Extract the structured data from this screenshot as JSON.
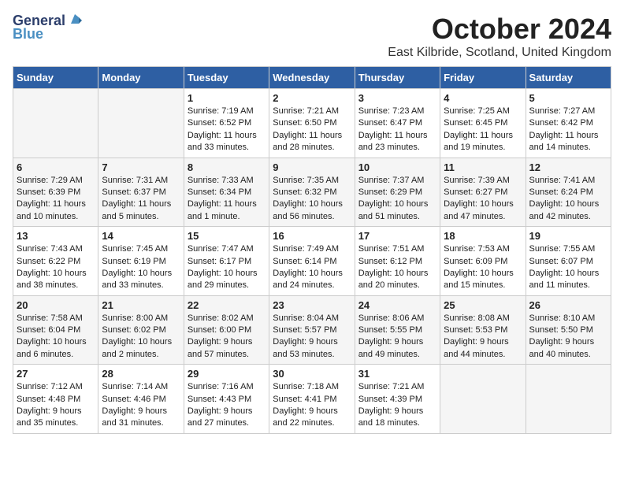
{
  "logo": {
    "general": "General",
    "blue": "Blue"
  },
  "title": "October 2024",
  "location": "East Kilbride, Scotland, United Kingdom",
  "days_of_week": [
    "Sunday",
    "Monday",
    "Tuesday",
    "Wednesday",
    "Thursday",
    "Friday",
    "Saturday"
  ],
  "weeks": [
    [
      {
        "day": "",
        "info": ""
      },
      {
        "day": "",
        "info": ""
      },
      {
        "day": "1",
        "info": "Sunrise: 7:19 AM\nSunset: 6:52 PM\nDaylight: 11 hours\nand 33 minutes."
      },
      {
        "day": "2",
        "info": "Sunrise: 7:21 AM\nSunset: 6:50 PM\nDaylight: 11 hours\nand 28 minutes."
      },
      {
        "day": "3",
        "info": "Sunrise: 7:23 AM\nSunset: 6:47 PM\nDaylight: 11 hours\nand 23 minutes."
      },
      {
        "day": "4",
        "info": "Sunrise: 7:25 AM\nSunset: 6:45 PM\nDaylight: 11 hours\nand 19 minutes."
      },
      {
        "day": "5",
        "info": "Sunrise: 7:27 AM\nSunset: 6:42 PM\nDaylight: 11 hours\nand 14 minutes."
      }
    ],
    [
      {
        "day": "6",
        "info": "Sunrise: 7:29 AM\nSunset: 6:39 PM\nDaylight: 11 hours\nand 10 minutes."
      },
      {
        "day": "7",
        "info": "Sunrise: 7:31 AM\nSunset: 6:37 PM\nDaylight: 11 hours\nand 5 minutes."
      },
      {
        "day": "8",
        "info": "Sunrise: 7:33 AM\nSunset: 6:34 PM\nDaylight: 11 hours\nand 1 minute."
      },
      {
        "day": "9",
        "info": "Sunrise: 7:35 AM\nSunset: 6:32 PM\nDaylight: 10 hours\nand 56 minutes."
      },
      {
        "day": "10",
        "info": "Sunrise: 7:37 AM\nSunset: 6:29 PM\nDaylight: 10 hours\nand 51 minutes."
      },
      {
        "day": "11",
        "info": "Sunrise: 7:39 AM\nSunset: 6:27 PM\nDaylight: 10 hours\nand 47 minutes."
      },
      {
        "day": "12",
        "info": "Sunrise: 7:41 AM\nSunset: 6:24 PM\nDaylight: 10 hours\nand 42 minutes."
      }
    ],
    [
      {
        "day": "13",
        "info": "Sunrise: 7:43 AM\nSunset: 6:22 PM\nDaylight: 10 hours\nand 38 minutes."
      },
      {
        "day": "14",
        "info": "Sunrise: 7:45 AM\nSunset: 6:19 PM\nDaylight: 10 hours\nand 33 minutes."
      },
      {
        "day": "15",
        "info": "Sunrise: 7:47 AM\nSunset: 6:17 PM\nDaylight: 10 hours\nand 29 minutes."
      },
      {
        "day": "16",
        "info": "Sunrise: 7:49 AM\nSunset: 6:14 PM\nDaylight: 10 hours\nand 24 minutes."
      },
      {
        "day": "17",
        "info": "Sunrise: 7:51 AM\nSunset: 6:12 PM\nDaylight: 10 hours\nand 20 minutes."
      },
      {
        "day": "18",
        "info": "Sunrise: 7:53 AM\nSunset: 6:09 PM\nDaylight: 10 hours\nand 15 minutes."
      },
      {
        "day": "19",
        "info": "Sunrise: 7:55 AM\nSunset: 6:07 PM\nDaylight: 10 hours\nand 11 minutes."
      }
    ],
    [
      {
        "day": "20",
        "info": "Sunrise: 7:58 AM\nSunset: 6:04 PM\nDaylight: 10 hours\nand 6 minutes."
      },
      {
        "day": "21",
        "info": "Sunrise: 8:00 AM\nSunset: 6:02 PM\nDaylight: 10 hours\nand 2 minutes."
      },
      {
        "day": "22",
        "info": "Sunrise: 8:02 AM\nSunset: 6:00 PM\nDaylight: 9 hours\nand 57 minutes."
      },
      {
        "day": "23",
        "info": "Sunrise: 8:04 AM\nSunset: 5:57 PM\nDaylight: 9 hours\nand 53 minutes."
      },
      {
        "day": "24",
        "info": "Sunrise: 8:06 AM\nSunset: 5:55 PM\nDaylight: 9 hours\nand 49 minutes."
      },
      {
        "day": "25",
        "info": "Sunrise: 8:08 AM\nSunset: 5:53 PM\nDaylight: 9 hours\nand 44 minutes."
      },
      {
        "day": "26",
        "info": "Sunrise: 8:10 AM\nSunset: 5:50 PM\nDaylight: 9 hours\nand 40 minutes."
      }
    ],
    [
      {
        "day": "27",
        "info": "Sunrise: 7:12 AM\nSunset: 4:48 PM\nDaylight: 9 hours\nand 35 minutes."
      },
      {
        "day": "28",
        "info": "Sunrise: 7:14 AM\nSunset: 4:46 PM\nDaylight: 9 hours\nand 31 minutes."
      },
      {
        "day": "29",
        "info": "Sunrise: 7:16 AM\nSunset: 4:43 PM\nDaylight: 9 hours\nand 27 minutes."
      },
      {
        "day": "30",
        "info": "Sunrise: 7:18 AM\nSunset: 4:41 PM\nDaylight: 9 hours\nand 22 minutes."
      },
      {
        "day": "31",
        "info": "Sunrise: 7:21 AM\nSunset: 4:39 PM\nDaylight: 9 hours\nand 18 minutes."
      },
      {
        "day": "",
        "info": ""
      },
      {
        "day": "",
        "info": ""
      }
    ]
  ]
}
